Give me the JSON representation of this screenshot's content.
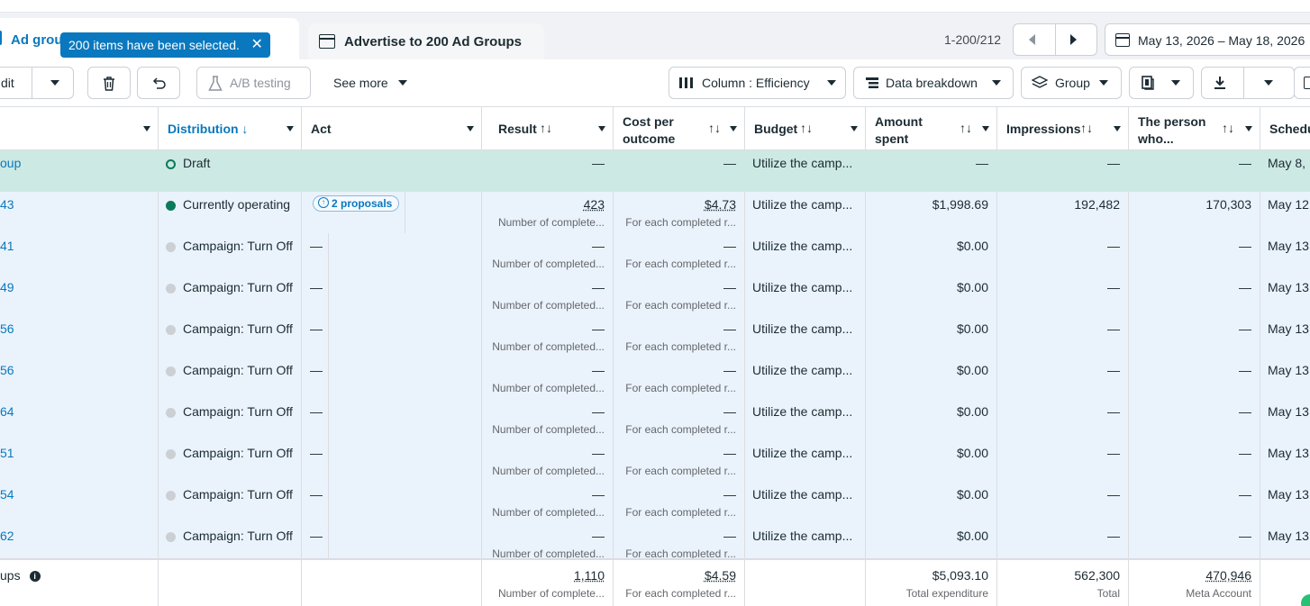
{
  "tabs": {
    "active_label": "Ad group",
    "selection_text": "200 items have been selected.",
    "selection_close": "✕",
    "second_label": "Advertise to 200 Ad Groups"
  },
  "pagination": {
    "range": "1-200/212"
  },
  "date_range": "May 13, 2026 – May 18, 2026",
  "toolbar": {
    "edit_label": "dit",
    "ab_testing": "A/B testing",
    "see_more": "See more",
    "column": "Column : Efficiency",
    "breakdown": "Data breakdown",
    "group": "Group"
  },
  "columns": {
    "distribution": "Distribution ↓",
    "act": "Act",
    "result": "Result",
    "cost_per_outcome": "Cost per outcome",
    "budget": "Budget",
    "amount_spent": "Amount spent",
    "impressions": "Impressions",
    "person_who": "The person who...",
    "schedule": "Schedu",
    "sort_icon": "↑↓"
  },
  "rows": [
    {
      "name": "oup",
      "status": "Draft",
      "dot": "open",
      "act": "",
      "result": "—",
      "result_sub": "",
      "cost": "—",
      "cost_sub": "",
      "budget": "Utilize the camp...",
      "spent": "—",
      "impressions": "—",
      "person": "—",
      "schedule": "May 8,"
    },
    {
      "name": "43",
      "status": "Currently operating",
      "dot": "green",
      "act": "2 proposals",
      "result": "423",
      "result_sub": "Number of complete...",
      "cost": "$4.73",
      "cost_sub": "For each completed r...",
      "budget": "Utilize the camp...",
      "spent": "$1,998.69",
      "impressions": "192,482",
      "person": "170,303",
      "schedule": "May 12,"
    },
    {
      "name": "41",
      "status": "Campaign: Turn Off",
      "dot": "grey",
      "act": "—",
      "result": "—",
      "result_sub": "Number of completed...",
      "cost": "—",
      "cost_sub": "For each completed r...",
      "budget": "Utilize the camp...",
      "spent": "$0.00",
      "impressions": "—",
      "person": "—",
      "schedule": "May 13,"
    },
    {
      "name": "49",
      "status": "Campaign: Turn Off",
      "dot": "grey",
      "act": "—",
      "result": "—",
      "result_sub": "Number of completed...",
      "cost": "—",
      "cost_sub": "For each completed r...",
      "budget": "Utilize the camp...",
      "spent": "$0.00",
      "impressions": "—",
      "person": "—",
      "schedule": "May 13,"
    },
    {
      "name": "56",
      "status": "Campaign: Turn Off",
      "dot": "grey",
      "act": "—",
      "result": "—",
      "result_sub": "Number of completed...",
      "cost": "—",
      "cost_sub": "For each completed r...",
      "budget": "Utilize the camp...",
      "spent": "$0.00",
      "impressions": "—",
      "person": "—",
      "schedule": "May 13,"
    },
    {
      "name": "56",
      "status": "Campaign: Turn Off",
      "dot": "grey",
      "act": "—",
      "result": "—",
      "result_sub": "Number of completed...",
      "cost": "—",
      "cost_sub": "For each completed r...",
      "budget": "Utilize the camp...",
      "spent": "$0.00",
      "impressions": "—",
      "person": "—",
      "schedule": "May 13,"
    },
    {
      "name": "64",
      "status": "Campaign: Turn Off",
      "dot": "grey",
      "act": "—",
      "result": "—",
      "result_sub": "Number of completed...",
      "cost": "—",
      "cost_sub": "For each completed r...",
      "budget": "Utilize the camp...",
      "spent": "$0.00",
      "impressions": "—",
      "person": "—",
      "schedule": "May 13,"
    },
    {
      "name": "51",
      "status": "Campaign: Turn Off",
      "dot": "grey",
      "act": "—",
      "result": "—",
      "result_sub": "Number of completed...",
      "cost": "—",
      "cost_sub": "For each completed r...",
      "budget": "Utilize the camp...",
      "spent": "$0.00",
      "impressions": "—",
      "person": "—",
      "schedule": "May 13,"
    },
    {
      "name": "54",
      "status": "Campaign: Turn Off",
      "dot": "grey",
      "act": "—",
      "result": "—",
      "result_sub": "Number of completed...",
      "cost": "—",
      "cost_sub": "For each completed r...",
      "budget": "Utilize the camp...",
      "spent": "$0.00",
      "impressions": "—",
      "person": "—",
      "schedule": "May 13,"
    },
    {
      "name": "62",
      "status": "Campaign: Turn Off",
      "dot": "grey",
      "act": "—",
      "result": "—",
      "result_sub": "Number of completed...",
      "cost": "—",
      "cost_sub": "For each completed r...",
      "budget": "Utilize the camp...",
      "spent": "$0.00",
      "impressions": "—",
      "person": "—",
      "schedule": "May 13,"
    }
  ],
  "footer": {
    "label": "ups",
    "result": "1,110",
    "result_sub": "Number of complete...",
    "cost": "$4.59",
    "cost_sub": "For each completed r...",
    "spent": "$5,093.10",
    "spent_sub": "Total expenditure",
    "impressions": "562,300",
    "impressions_sub": "Total",
    "person": "470,946",
    "person_sub": "Meta Account"
  }
}
